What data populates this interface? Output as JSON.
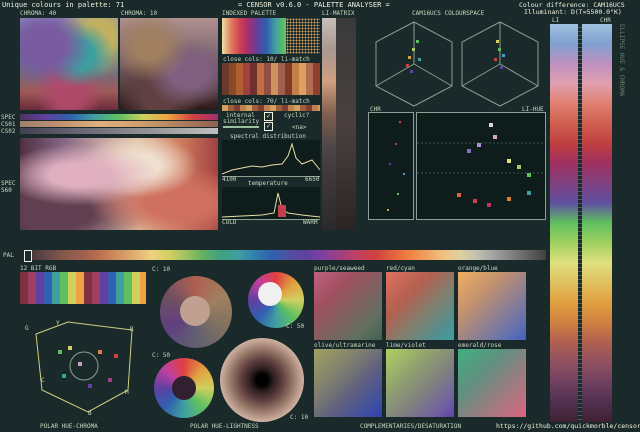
{
  "header": {
    "unique_colours": "Unique colours in palette: 71",
    "title": "= CENSOR v0.6.0 - PALETTE ANALYSER =",
    "colour_difference": "Colour difference: CAM16UCS",
    "illuminant": "Illuminant: D(T=5500.0°K)"
  },
  "labels": {
    "chroma40": "CHROMA: 40",
    "chroma10": "CHROMA: 10",
    "indexed": "INDEXED PALETTE",
    "li_matrix": "LI-MATRIX",
    "cam16": "CAM16UCS COLOURSPACE",
    "li": "LI",
    "chr": "CHR",
    "chr2": "CHR",
    "li_hue": "LI-HUE",
    "close_10": "close cols: 10/ li-match",
    "close_70": "close cols: 70/ li-match",
    "internal": "internal",
    "similarity": "similarity",
    "cyclic": "cyclic?",
    "na": "<na>",
    "spectral": "spectral distribution",
    "s4100": "4100",
    "s6650": "6650",
    "temperature": "temperature",
    "cold": "COLD",
    "warm": "WARM",
    "spec1": "SPEC",
    "cs01": "CS01",
    "cs02": "CS02",
    "spec2": "SPEC",
    "s60": "S60",
    "pal": "PAL",
    "rgb12": "12 BIT RGB",
    "c10a": "C: 10",
    "c50a": "C: 50",
    "c50b": "C: 50",
    "c10b": "C: 10",
    "purple_seaweed": "purple/seaweed",
    "red_cyan": "red/cyan",
    "orange_blue": "orange/blue",
    "olive_ultramarine": "olive/ultramarine",
    "lime_violet": "lime/violet",
    "emerald_rose": "emerald/rose",
    "polar_hue_chroma": "POLAR HUE-CHROMA",
    "polar_hue_lightness": "POLAR HUE-LIGHTNESS",
    "complementaries": "COMPLEMENTARIES/DESATURATION",
    "github": "https://github.com/quickmorble/censor",
    "hue_letters": {
      "G": "G",
      "Y": "Y",
      "R": "R",
      "C": "C",
      "M": "M",
      "B": "B"
    },
    "side_text": "ELLIPSE HUE & CHROMA"
  },
  "checks": {
    "internal": "✓",
    "cyclic": "✓"
  },
  "colors": {
    "bg": "#1a2a2a",
    "panel": "#0e1c1c",
    "frame": "#8aa090",
    "text": "#f0f4e0"
  }
}
